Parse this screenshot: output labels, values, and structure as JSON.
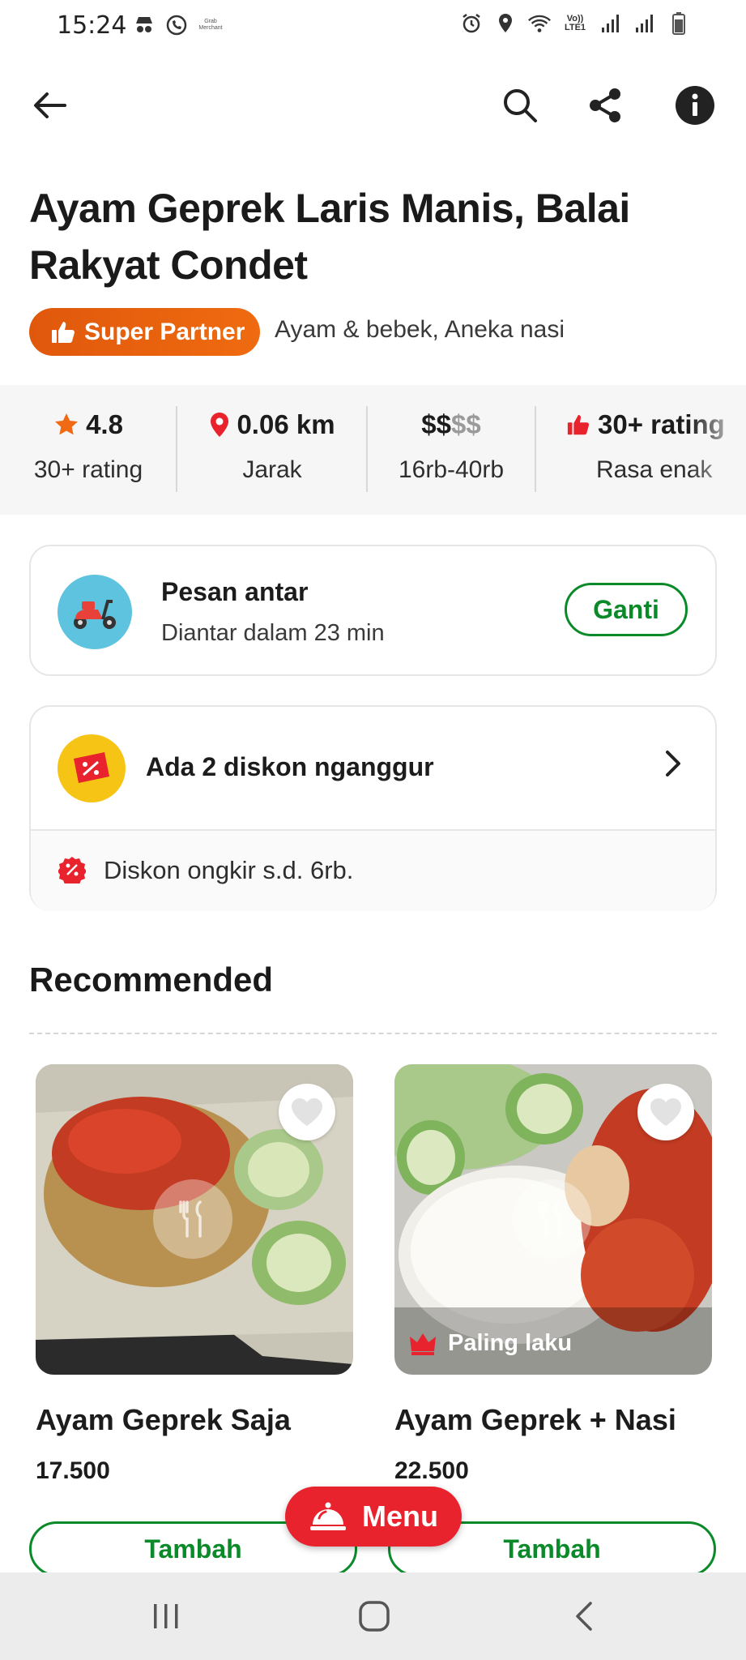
{
  "status_bar": {
    "time": "15:24",
    "left_icons": [
      "incognito-icon",
      "whatsapp-icon",
      "grab-merchant-icon"
    ],
    "grab_merchant_text": "Grab Merchant",
    "right_icons": [
      "alarm-icon",
      "location-icon",
      "wifi-icon",
      "volte-icon",
      "signal-icon",
      "signal-icon",
      "battery-icon"
    ],
    "volte_text": "Vo)) LTE1"
  },
  "app_bar": {
    "back_icon": "arrow-left-icon",
    "search_icon": "search-icon",
    "share_icon": "share-icon",
    "info_icon": "info-icon"
  },
  "restaurant": {
    "title": "Ayam Geprek Laris Manis, Balai Rakyat Condet",
    "badge_label": "Super Partner",
    "cuisine": "Ayam & bebek, Aneka nasi"
  },
  "stats": [
    {
      "value": "4.8",
      "label": "30+ rating",
      "icon": "star-icon"
    },
    {
      "value": "0.06 km",
      "label": "Jarak",
      "icon": "location-pin-icon"
    },
    {
      "value_dark": "$$",
      "value_light": "$$",
      "label": "16rb-40rb"
    },
    {
      "value": "30+ rating",
      "label": "Rasa enak",
      "icon": "thumbs-up-icon"
    }
  ],
  "delivery": {
    "title": "Pesan antar",
    "subtitle": "Diantar dalam 23 min",
    "change_label": "Ganti"
  },
  "discount": {
    "title": "Ada 2 diskon nganggur",
    "subtitle": "Diskon ongkir s.d. 6rb."
  },
  "section": {
    "title": "Recommended"
  },
  "products": [
    {
      "name": "Ayam Geprek Saja",
      "price": "17.500",
      "add_label": "Tambah",
      "badge": ""
    },
    {
      "name": "Ayam Geprek + Nasi",
      "price": "22.500",
      "add_label": "Tambah",
      "badge": "Paling laku"
    }
  ],
  "menu_button": {
    "label": "Menu"
  },
  "colors": {
    "brand_green": "#0b8a2a",
    "partner_orange": "#e85f0e",
    "menu_red": "#e8232e",
    "star_orange": "#f06a14",
    "pin_red": "#e8232e"
  }
}
